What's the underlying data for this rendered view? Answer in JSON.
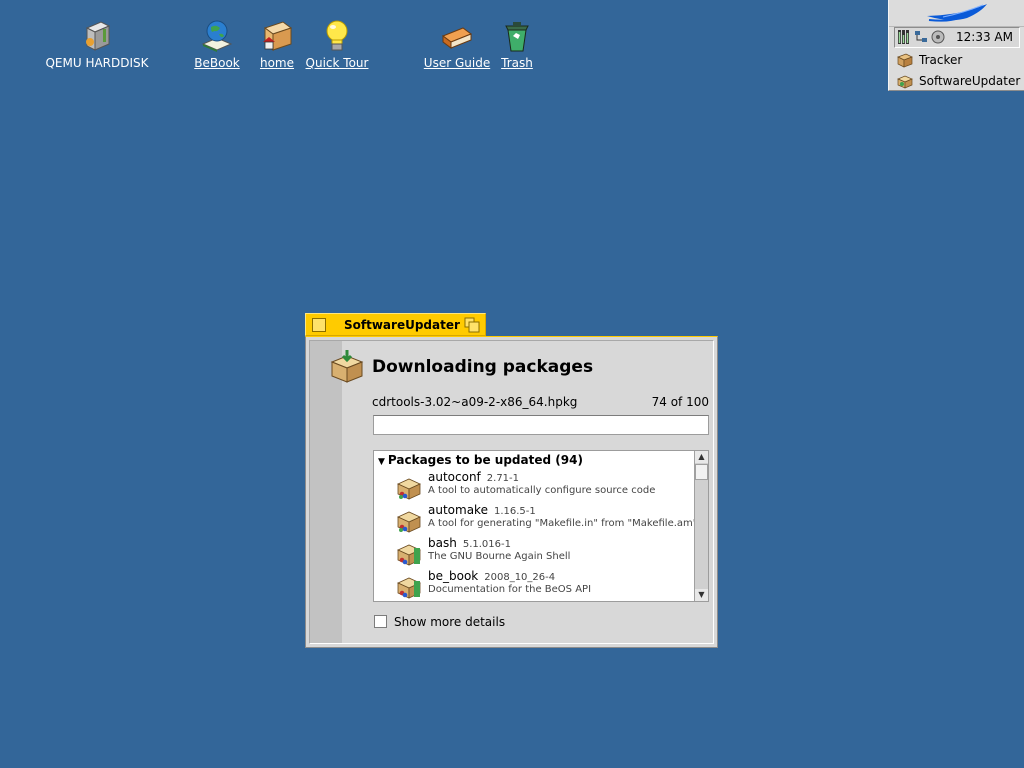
{
  "desktop": {
    "icons": [
      {
        "label": "QEMU HARDDISK",
        "icon": "harddisk-icon"
      },
      {
        "label": "BeBook",
        "icon": "globe-book-icon"
      },
      {
        "label": "home",
        "icon": "home-folder-icon"
      },
      {
        "label": "Quick Tour",
        "icon": "lightbulb-icon"
      },
      {
        "label": "User Guide",
        "icon": "book-icon"
      },
      {
        "label": "Trash",
        "icon": "trash-icon"
      }
    ]
  },
  "deskbar": {
    "clock": "12:33 AM",
    "items": [
      {
        "label": "Tracker",
        "icon": "tracker-icon"
      },
      {
        "label": "SoftwareUpdater",
        "icon": "package-icon"
      }
    ]
  },
  "window": {
    "title": "SoftwareUpdater",
    "heading": "Downloading packages",
    "current_file": "cdrtools-3.02~a09-2-x86_64.hpkg",
    "count": "74 of 100",
    "progress": 0,
    "group_label": "Packages to be updated (94)",
    "packages": [
      {
        "name": "autoconf",
        "version": "2.71-1",
        "description": "A tool to automatically configure source code"
      },
      {
        "name": "automake",
        "version": "1.16.5-1",
        "description": "A tool for generating \"Makefile.in\" from \"Makefile.am\""
      },
      {
        "name": "bash",
        "version": "5.1.016-1",
        "description": "The GNU Bourne Again Shell"
      },
      {
        "name": "be_book",
        "version": "2008_10_26-4",
        "description": "Documentation for the BeOS API"
      }
    ],
    "show_details_label": "Show more details",
    "show_details_checked": false
  },
  "colors": {
    "desktop": "#336699",
    "tab": "#ffcb00"
  }
}
